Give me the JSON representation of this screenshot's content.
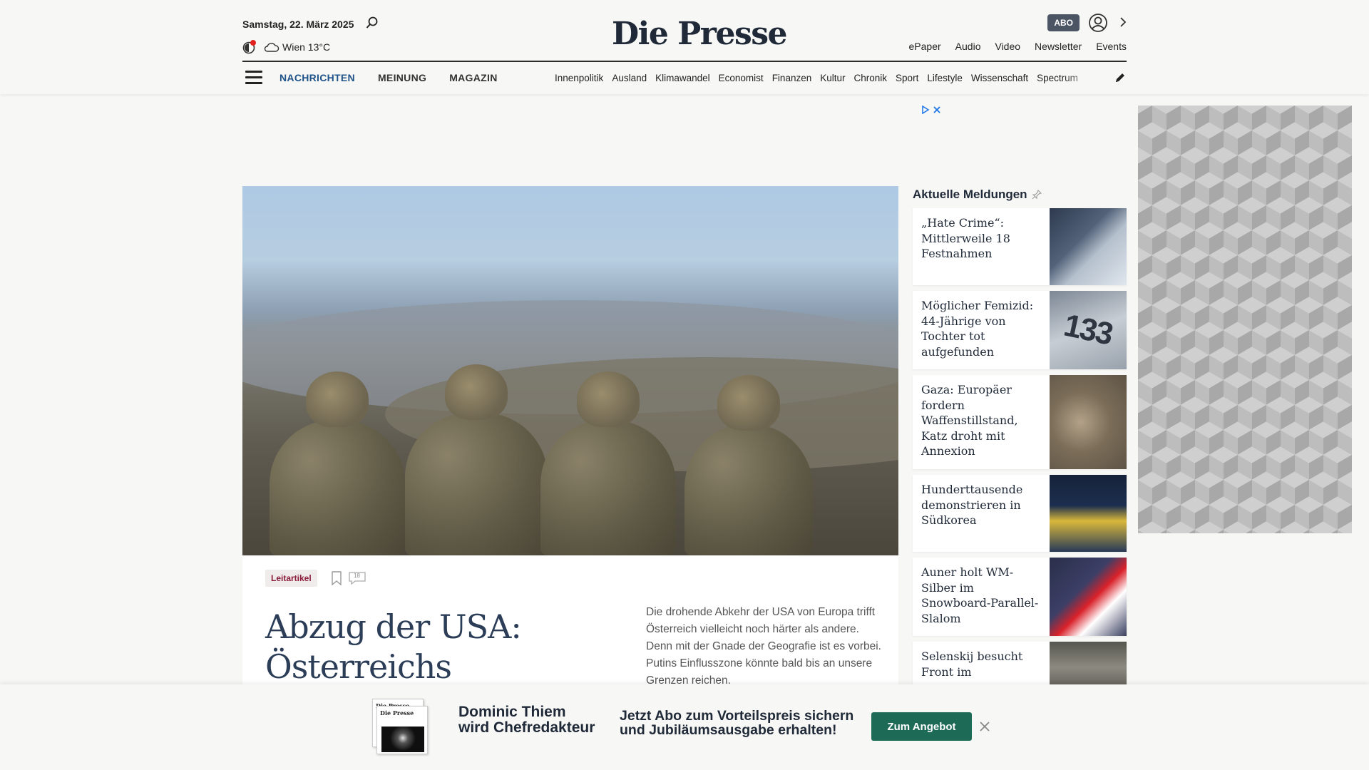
{
  "header": {
    "date": "Samstag, 22. März 2025",
    "weather": "Wien 13°C",
    "logo": "Die Presse",
    "abo_label": "ABO",
    "top_links": [
      "ePaper",
      "Audio",
      "Video",
      "Newsletter",
      "Events"
    ],
    "main_nav": [
      {
        "label": "NACHRICHTEN",
        "active": true
      },
      {
        "label": "MEINUNG",
        "active": false
      },
      {
        "label": "MAGAZIN",
        "active": false
      }
    ],
    "sub_nav": [
      "Innenpolitik",
      "Ausland",
      "Klimawandel",
      "Economist",
      "Finanzen",
      "Kultur",
      "Chronik",
      "Sport",
      "Lifestyle",
      "Wissenschaft",
      "Spectrum"
    ],
    "icons": [
      "search-icon",
      "dark-mode-icon",
      "cloud-icon",
      "user-icon",
      "chevron-right-icon",
      "hamburger-menu-icon",
      "pen-icon"
    ]
  },
  "ad": {
    "marker_icons": [
      "adchoices-play-icon",
      "ad-close-icon"
    ]
  },
  "article": {
    "tag": "Leitartikel",
    "comment_count": "18",
    "headline": "Abzug der USA: Österreichs",
    "teaser": "Die drohende Abkehr der USA von Europa trifft Österreich vielleicht noch härter als andere. Denn mit der Gnade der Geografie ist es vorbei. Putins Einflusszone könnte bald bis an unsere Grenzen reichen."
  },
  "sidebar": {
    "title": "Aktuelle Meldungen",
    "items": [
      {
        "title": "„Hate Crime“: Mittlerweile 18 Festnahmen"
      },
      {
        "title": "Möglicher Femizid: 44-Jährige von Tochter tot aufgefunden",
        "thumb_text": "133"
      },
      {
        "title": "Gaza: Europäer fordern Waffenstillstand, Katz droht mit Annexion"
      },
      {
        "title": "Hunderttausende demonstrieren in Südkorea"
      },
      {
        "title": "Auner holt WM-Silber im Snowboard-Parallel-Slalom"
      },
      {
        "title": "Selenskij besucht Front im"
      }
    ]
  },
  "banner": {
    "paper_logo": "Die Presse",
    "headline_1": "Dominic Thiem",
    "headline_2": "wird Chefredakteur",
    "sub_1": "Jetzt Abo zum Vorteilspreis sichern",
    "sub_2": "und Jubiläumsausgabe erhalten!",
    "cta": "Zum Angebot"
  },
  "colors": {
    "accent_nav": "#1f5289",
    "tag_text": "#8b1c3a",
    "cta_bg": "#1d6b57",
    "headline": "#2c3e57"
  }
}
